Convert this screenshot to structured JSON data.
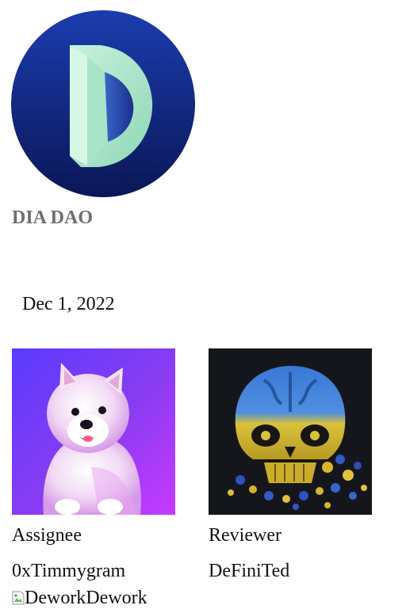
{
  "organization": {
    "name": "DIA DAO",
    "logo_icon": "dia-d-logo-icon",
    "logo_colors": {
      "circle_top": "#1a3aa6",
      "circle_bottom": "#0b1a5c",
      "letter_light": "#b9ecd2",
      "letter_dark": "#2a4bb8"
    }
  },
  "task": {
    "date": "Dec 1, 2022"
  },
  "assignee": {
    "role_label": "Assignee",
    "handle": "0xTimmygram",
    "avatar_icon": "white-dog-avatar"
  },
  "reviewer": {
    "role_label": "Reviewer",
    "handle": "DeFiniTed",
    "avatar_icon": "blue-yellow-skull-avatar"
  },
  "footer": {
    "brand_alt": "Dework",
    "brand_text": "Dework",
    "broken_image_icon": "broken-image-icon"
  }
}
